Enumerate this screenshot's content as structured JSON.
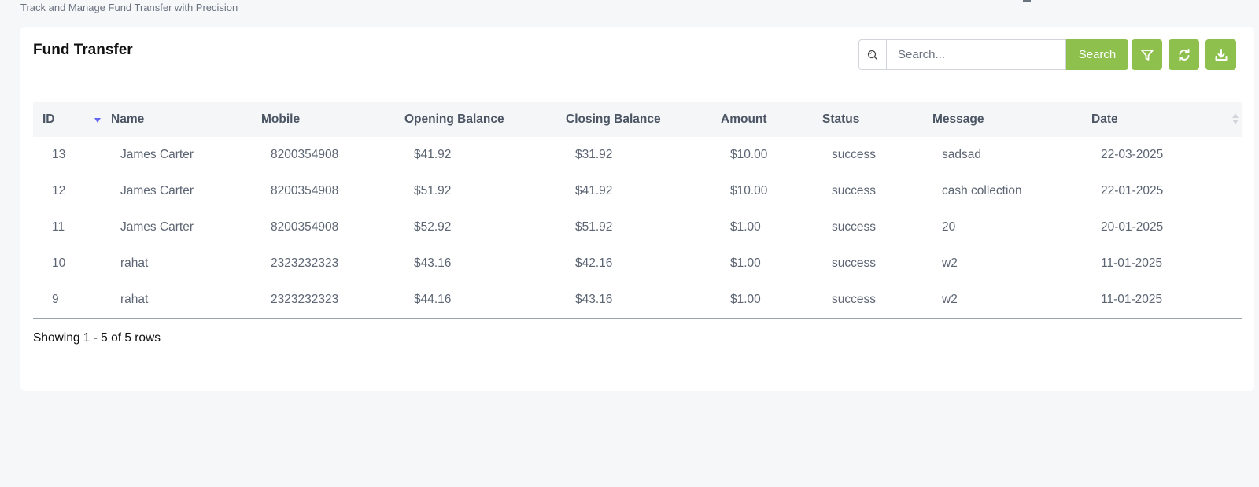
{
  "page": {
    "subtitle": "Track and Manage Fund Transfer with Precision"
  },
  "card": {
    "title": "Fund Transfer",
    "search": {
      "placeholder": "Search...",
      "value": "",
      "button_label": "Search"
    },
    "icons": {
      "search": "search-icon",
      "filter": "filter-icon",
      "refresh": "refresh-icon",
      "download": "download-icon"
    },
    "colors": {
      "accent": "#8dc04c",
      "sort_active": "#6366f1"
    }
  },
  "table": {
    "columns": [
      "ID",
      "Name",
      "Mobile",
      "Opening Balance",
      "Closing Balance",
      "Amount",
      "Status",
      "Message",
      "Date"
    ],
    "rows": [
      [
        "13",
        "James Carter",
        "8200354908",
        "$41.92",
        "$31.92",
        "$10.00",
        "success",
        "sadsad",
        "22-03-2025"
      ],
      [
        "12",
        "James Carter",
        "8200354908",
        "$51.92",
        "$41.92",
        "$10.00",
        "success",
        "cash collection",
        "22-01-2025"
      ],
      [
        "11",
        "James Carter",
        "8200354908",
        "$52.92",
        "$51.92",
        "$1.00",
        "success",
        "20",
        "20-01-2025"
      ],
      [
        "10",
        "rahat",
        "2323232323",
        "$43.16",
        "$42.16",
        "$1.00",
        "success",
        "w2",
        "11-01-2025"
      ],
      [
        "9",
        "rahat",
        "2323232323",
        "$44.16",
        "$43.16",
        "$1.00",
        "success",
        "w2",
        "11-01-2025"
      ]
    ],
    "footer": "Showing 1 - 5 of 5 rows"
  }
}
